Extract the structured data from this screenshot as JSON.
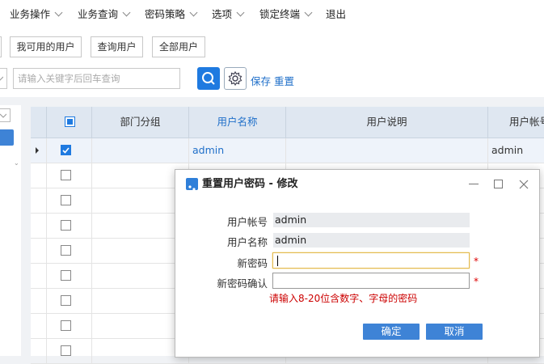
{
  "menu": {
    "items": [
      {
        "label": "业务操作",
        "has_dropdown": true
      },
      {
        "label": "业务查询",
        "has_dropdown": true
      },
      {
        "label": "密码策略",
        "has_dropdown": true
      },
      {
        "label": "选项",
        "has_dropdown": true
      },
      {
        "label": "锁定终端",
        "has_dropdown": true
      },
      {
        "label": "退出",
        "has_dropdown": false
      }
    ]
  },
  "toolbar": {
    "buttons": [
      "我可用的用户",
      "查询用户",
      "全部用户"
    ],
    "search_placeholder": "请输入关键字后回车查询",
    "search_icon": "search-icon",
    "settings_icon": "gear-icon",
    "save_label": "保存",
    "reset_label": "重置"
  },
  "table": {
    "columns": [
      "部门分组",
      "用户名称",
      "用户说明",
      "用户帐号"
    ],
    "sorted_column_index": 1,
    "rows": [
      {
        "checked": true,
        "current": true,
        "department": "",
        "name": "admin",
        "description": "",
        "account": "admin"
      },
      {
        "checked": false,
        "current": false,
        "department": "",
        "name": "",
        "description": "",
        "account": ""
      },
      {
        "checked": false,
        "current": false,
        "department": "",
        "name": "",
        "description": "",
        "account": ""
      },
      {
        "checked": false,
        "current": false,
        "department": "",
        "name": "",
        "description": "",
        "account": ""
      },
      {
        "checked": false,
        "current": false,
        "department": "",
        "name": "",
        "description": "",
        "account": ""
      },
      {
        "checked": false,
        "current": false,
        "department": "",
        "name": "",
        "description": "",
        "account": ""
      },
      {
        "checked": false,
        "current": false,
        "department": "",
        "name": "",
        "description": "",
        "account": ""
      },
      {
        "checked": false,
        "current": false,
        "department": "",
        "name": "",
        "description": "",
        "account": ""
      },
      {
        "checked": false,
        "current": false,
        "department": "",
        "name": "",
        "description": "",
        "account": ""
      }
    ]
  },
  "dialog": {
    "title": "重置用户密码 - 修改",
    "fields": {
      "account_label": "用户帐号",
      "account_value": "admin",
      "name_label": "用户名称",
      "name_value": "admin",
      "new_password_label": "新密码",
      "confirm_password_label": "新密码确认",
      "required_mark": "*"
    },
    "hint": "请输入8-20位含数字、字母的密码",
    "ok_label": "确定",
    "cancel_label": "取消"
  },
  "colors": {
    "accent": "#1f7ae0",
    "header_bg": "#dfe7f1",
    "dialog_button": "#3e83d6",
    "error_text": "#cc0000"
  }
}
